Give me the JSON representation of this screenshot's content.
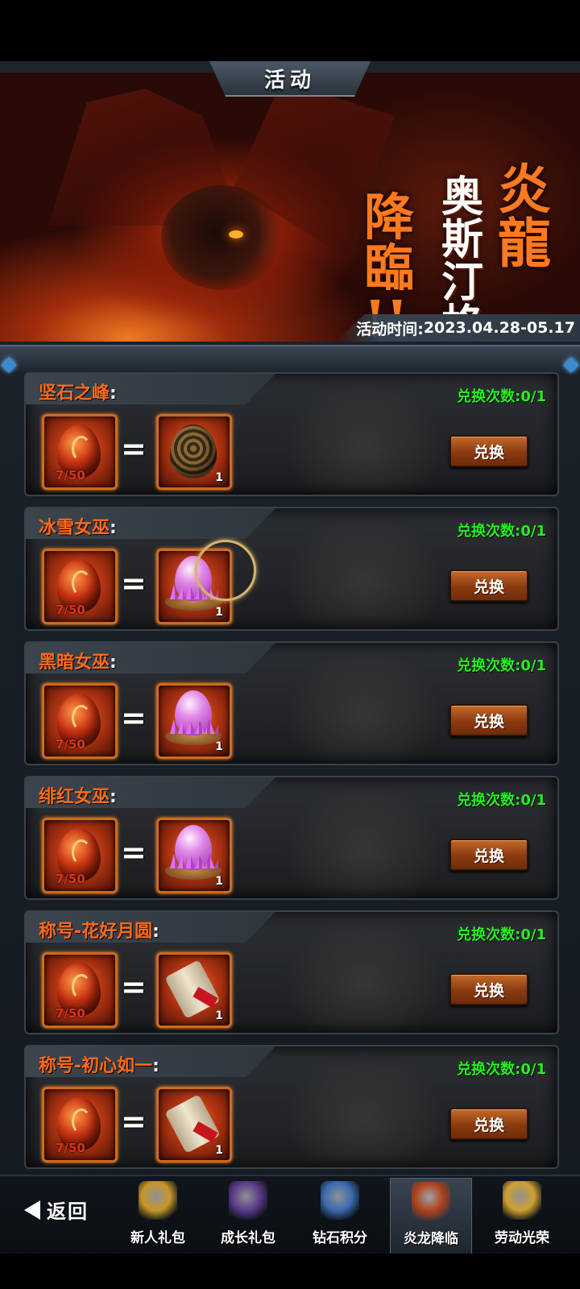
{
  "header": {
    "title": "活动"
  },
  "banner": {
    "title_chars_a": [
      "降",
      "臨",
      "!!"
    ],
    "title_chars_b": [
      "奥",
      "斯",
      "汀",
      "格"
    ],
    "title_chars_c": [
      "炎",
      "龍"
    ],
    "period_label": "活动时间:",
    "period_value": "2023.04.28-05.17"
  },
  "exchange": {
    "count_label": "兑换次数:",
    "button_label": "兑换",
    "equals": "=",
    "rows": [
      {
        "name": "坚石之峰",
        "colon": ":",
        "count": "0/1",
        "cost": "7/50",
        "qty": "1",
        "reward": "stone-egg-icon"
      },
      {
        "name": "冰雪女巫",
        "colon": ":",
        "count": "0/1",
        "cost": "7/50",
        "qty": "1",
        "reward": "crystal-egg-icon"
      },
      {
        "name": "黑暗女巫",
        "colon": ":",
        "count": "0/1",
        "cost": "7/50",
        "qty": "1",
        "reward": "crystal-egg-icon"
      },
      {
        "name": "绯红女巫",
        "colon": ":",
        "count": "0/1",
        "cost": "7/50",
        "qty": "1",
        "reward": "crystal-egg-icon"
      },
      {
        "name": "称号-花好月圆",
        "colon": ":",
        "count": "0/1",
        "cost": "7/50",
        "qty": "1",
        "reward": "scroll-icon"
      },
      {
        "name": "称号-初心如一",
        "colon": ":",
        "count": "0/1",
        "cost": "7/50",
        "qty": "1",
        "reward": "scroll-icon"
      }
    ]
  },
  "nav": {
    "back_label": "返回",
    "tabs": [
      {
        "label": "新人礼包",
        "icon": "treasure-chest-icon",
        "color": "#c8962a"
      },
      {
        "label": "成长礼包",
        "icon": "hooded-mage-icon",
        "color": "#5a3a8a"
      },
      {
        "label": "钻石积分",
        "icon": "robot-knight-icon",
        "color": "#3a6ab0"
      },
      {
        "label": "炎龙降临",
        "icon": "dragon-icon",
        "color": "#b0401a",
        "active": true
      },
      {
        "label": "劳动光荣",
        "icon": "wheat-icon",
        "color": "#d0a030"
      }
    ]
  }
}
